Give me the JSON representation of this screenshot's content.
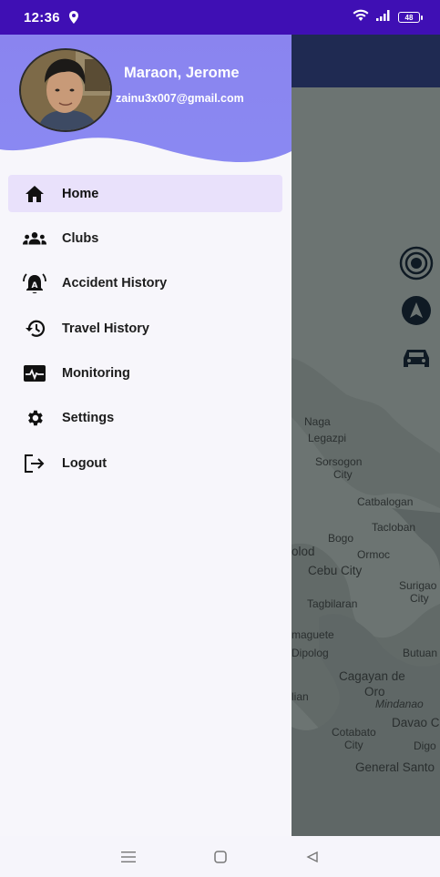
{
  "status_bar": {
    "time": "12:36",
    "battery": "48",
    "icons": [
      "location-icon",
      "wifi-icon",
      "signal-icon",
      "battery-icon"
    ]
  },
  "drawer": {
    "header": {
      "name": "Maraon, Jerome",
      "email": "zainu3x007@gmail.com",
      "background_color": "#8c86f0"
    },
    "menu": [
      {
        "label": "Home",
        "icon": "home-icon",
        "active": true
      },
      {
        "label": "Clubs",
        "icon": "group-icon",
        "active": false
      },
      {
        "label": "Accident History",
        "icon": "alarm-bell-icon",
        "active": false
      },
      {
        "label": "Travel History",
        "icon": "history-icon",
        "active": false
      },
      {
        "label": "Monitoring",
        "icon": "monitor-pulse-icon",
        "active": false
      },
      {
        "label": "Settings",
        "icon": "gear-icon",
        "active": false
      },
      {
        "label": "Logout",
        "icon": "logout-icon",
        "active": false
      }
    ],
    "active_bg_color": "#e9e1fb"
  },
  "map": {
    "buttons": [
      "target-location-icon",
      "navigation-arrow-icon",
      "car-icon"
    ],
    "place_labels": [
      "Naga",
      "Legazpi",
      "Sorsogon",
      "City",
      "Catbalogan",
      "Tacloban",
      "Bogo",
      "Ormoc",
      "olod",
      "Cebu City",
      "Surigao",
      "City",
      "Tagbilaran",
      "maguete",
      "Dipolog",
      "Butuan",
      "Cagayan de",
      "Oro",
      "Mindanao",
      "lian",
      "Davao C",
      "Cotabato",
      "City",
      "Digo",
      "General Santo"
    ]
  },
  "nav_bar": {
    "icons": [
      "menu-lines-icon",
      "home-square-icon",
      "back-triangle-icon"
    ]
  }
}
